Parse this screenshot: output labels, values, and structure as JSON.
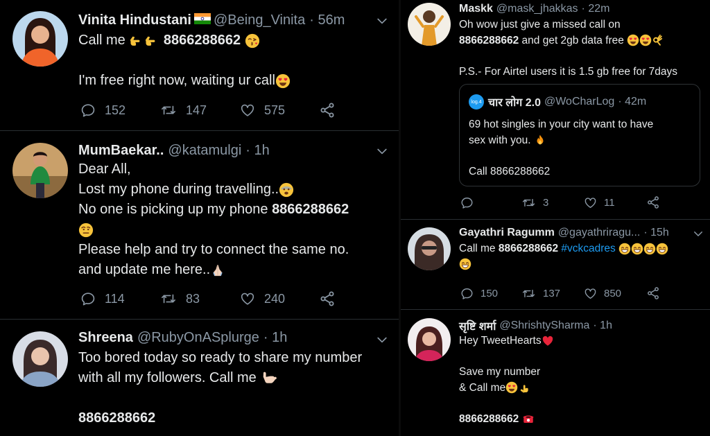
{
  "left_tweets": [
    {
      "name": "Vinita Hindustani",
      "handle": "@Being_Vinita",
      "time": "· 56m",
      "text_line1_prefix": "Call me",
      "phone": "8866288662",
      "text_line2": "I'm free right now, waiting ur call",
      "replies": "152",
      "retweets": "147",
      "likes": "575"
    },
    {
      "name": "MumBaekar..",
      "handle": "@katamulgi",
      "time": "· 1h",
      "line1": "Dear All,",
      "line2": "Lost my phone during travelling..",
      "line3_prefix": "No one is picking up my phone",
      "phone": "8866288662",
      "line5": "Please help and try to connect the same no.",
      "line6": "and update me here..",
      "replies": "114",
      "retweets": "83",
      "likes": "240"
    },
    {
      "name": "Shreena",
      "handle": "@RubyOnASplurge",
      "time": "· 1h",
      "line1": "Too bored today so ready to share my number",
      "line2": "with all my followers. Call me",
      "phone": "8866288662"
    }
  ],
  "right_tweets": [
    {
      "name": "Maskk",
      "handle": "@mask_jhakkas",
      "time": "· 22m",
      "line1": "Oh wow just give a missed call on",
      "phone": "8866288662",
      "line2_suffix": "and get 2gb data free",
      "line3": "P.S.- For Airtel users it is 1.5 gb free for 7days",
      "quote": {
        "avatar_text": "log.4",
        "name": "चार लोग 2.0",
        "handle": "@WoCharLog",
        "time": "· 42m",
        "line1": "69 hot singles in your city want to have",
        "line2": "sex with you.",
        "line3": "Call 8866288662"
      },
      "replies": "",
      "retweets": "3",
      "likes": "11"
    },
    {
      "name": "Gayathri Ragumm",
      "handle": "@gayathriragu...",
      "time": "· 15h",
      "prefix": "Call me",
      "phone": "8866288662",
      "hashtag": "#vckcadres",
      "replies": "150",
      "retweets": "137",
      "likes": "850"
    },
    {
      "name": "सृष्टि शर्मा",
      "handle": "@ShrishtySharma",
      "time": "· 1h",
      "line1": "Hey TweetHearts",
      "line2": "Save my number",
      "line3": "& Call me",
      "phone": "8866288662"
    }
  ],
  "icons": [
    "reply-icon",
    "retweet-icon",
    "like-icon",
    "share-icon",
    "chevron-down-icon",
    "india-flag-icon"
  ],
  "colors": {
    "background": "#000000",
    "text": "#e7e9ea",
    "muted": "#8b98a5",
    "hashtag": "#1d9bf0",
    "divider": "#2a2f33"
  }
}
